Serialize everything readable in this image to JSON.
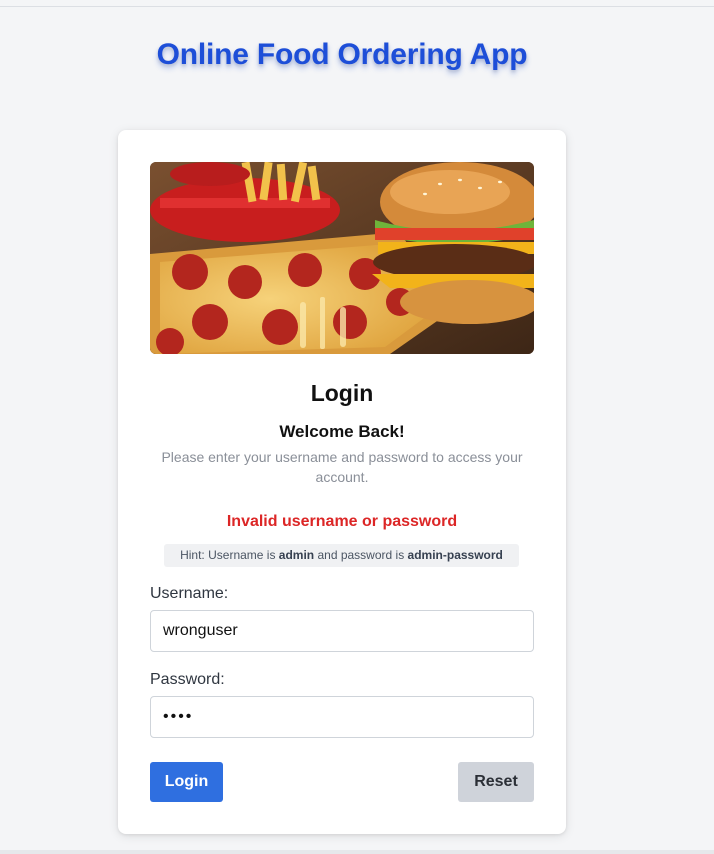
{
  "app": {
    "title": "Online Food Ordering App"
  },
  "login": {
    "heading": "Login",
    "welcome": "Welcome Back!",
    "subtext": "Please enter your username and password to access your account.",
    "error": "Invalid username or password",
    "hint": {
      "prefix": "Hint: Username is ",
      "username": "admin",
      "middle": " and password is ",
      "password": "admin-password"
    },
    "username_label": "Username:",
    "username_value": "wronguser",
    "password_label": "Password:",
    "password_mask": "••••",
    "login_button": "Login",
    "reset_button": "Reset"
  },
  "colors": {
    "title": "#1d4ed8",
    "error": "#dc2626",
    "login_button": "#2f6fe0",
    "reset_button": "#cfd3da"
  },
  "hero_image": "food-banner-image"
}
